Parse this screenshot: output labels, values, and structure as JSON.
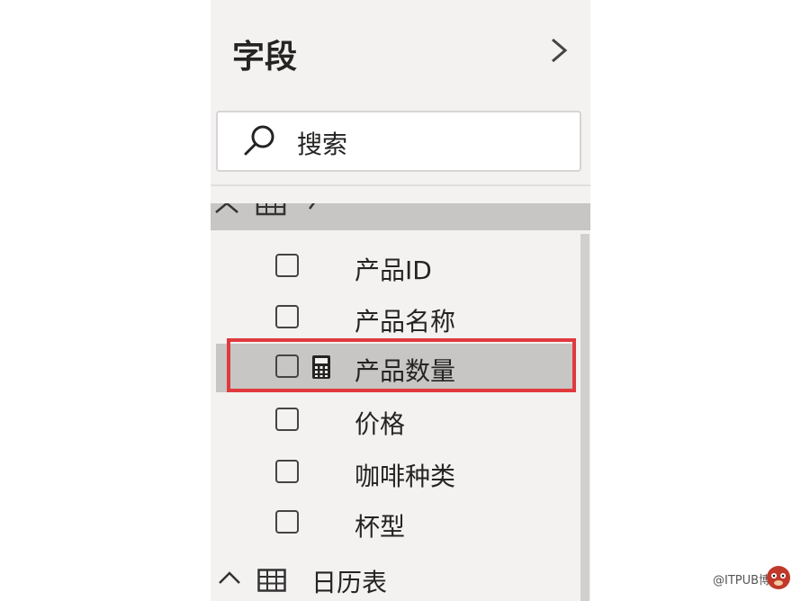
{
  "panel": {
    "title": "字段",
    "collapse_icon": "chevron-right-icon"
  },
  "search": {
    "icon": "search-icon",
    "placeholder": "搜索"
  },
  "tables": [
    {
      "name": "产品表",
      "expanded": true,
      "fields": [
        {
          "label": "产品ID",
          "checked": false,
          "icon": ""
        },
        {
          "label": "产品名称",
          "checked": false,
          "icon": ""
        },
        {
          "label": "产品数量",
          "checked": false,
          "icon": "calculator-icon",
          "selected": true
        },
        {
          "label": "价格",
          "checked": false,
          "icon": ""
        },
        {
          "label": "咖啡种类",
          "checked": false,
          "icon": ""
        },
        {
          "label": "杯型",
          "checked": false,
          "icon": ""
        }
      ]
    },
    {
      "name": "日历表",
      "expanded": true,
      "fields": []
    }
  ],
  "highlight_color": "#e03a3e",
  "watermark": {
    "text": "@ITPUB博客"
  }
}
